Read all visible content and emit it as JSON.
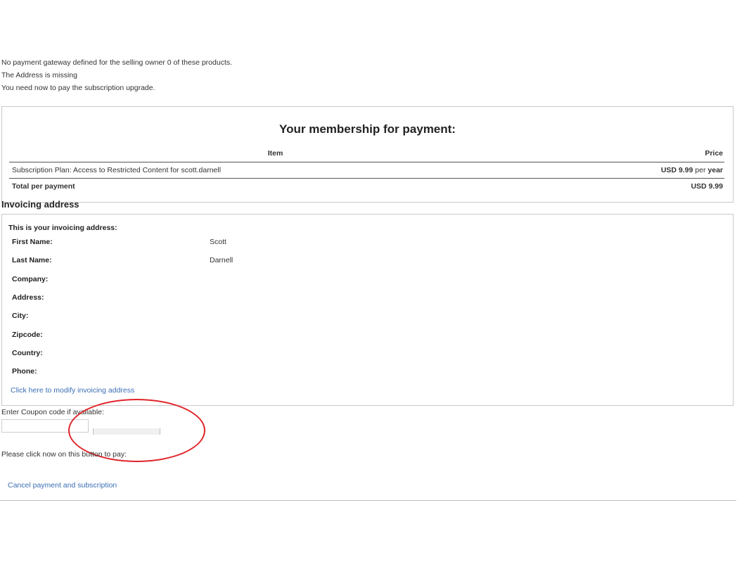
{
  "messages": [
    "No payment gateway defined for the selling owner 0 of these products.",
    "The Address is missing",
    "You need now to pay the subscription upgrade."
  ],
  "membership": {
    "title": "Your membership for payment:",
    "headers": {
      "item": "Item",
      "price": "Price"
    },
    "row": {
      "item": "Subscription Plan: Access to Restricted Content for scott.darnell",
      "price_amount": "USD 9.99",
      "price_per": " per ",
      "price_period": "year"
    },
    "total": {
      "label": "Total per payment",
      "value": "USD 9.99"
    }
  },
  "invoicing": {
    "title": "Invoicing address",
    "intro": "This is your invoicing address:",
    "fields": [
      {
        "label": "First Name:",
        "value": "Scott"
      },
      {
        "label": "Last Name:",
        "value": "Darnell"
      },
      {
        "label": "Company:",
        "value": ""
      },
      {
        "label": "Address:",
        "value": ""
      },
      {
        "label": "City:",
        "value": ""
      },
      {
        "label": "Zipcode:",
        "value": ""
      },
      {
        "label": "Country:",
        "value": ""
      },
      {
        "label": "Phone:",
        "value": ""
      }
    ],
    "modify_link": "Click here to modify invoicing address"
  },
  "coupon": {
    "label": "Enter Coupon code if available:",
    "value": "",
    "button_label": ""
  },
  "pay_message": "Please click now on this button to pay:",
  "cancel_link": "Cancel payment and subscription",
  "colors": {
    "link": "#3a6fb5",
    "annotation": "#e0242a",
    "border": "#c9c9c9"
  }
}
